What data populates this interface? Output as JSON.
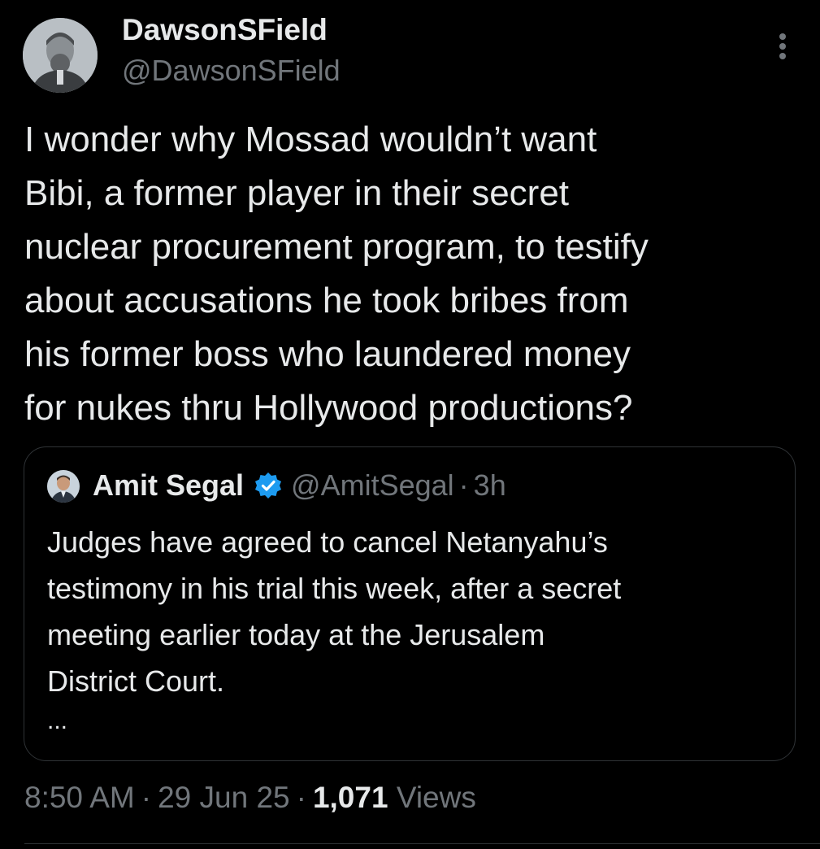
{
  "author": {
    "display_name": "DawsonSField",
    "handle": "@DawsonSField",
    "avatar_icon": "portrait-avatar"
  },
  "tweet_text": "I wonder why Mossad wouldn’t want\nBibi, a former player in their secret\nnuclear procurement program, to testify\nabout accusations he took bribes from\nhis former boss who laundered money\nfor nukes thru Hollywood productions?",
  "quoted_tweet": {
    "display_name": "Amit Segal",
    "verified_icon": "verified-badge-icon",
    "handle": "@AmitSegal",
    "separator": "·",
    "time": "3h",
    "text": "Judges have agreed to cancel Netanyahu’s\ntestimony in his trial this week, after a secret\nmeeting earlier today at the Jerusalem\nDistrict Court.",
    "ellipsis": "..."
  },
  "meta": {
    "time": "8:50 AM",
    "separator": "·",
    "date": "29 Jun 25",
    "views_count": "1,071",
    "views_label": "Views"
  },
  "colors": {
    "background": "#000000",
    "text_primary": "#e7e9ea",
    "text_secondary": "#71767b",
    "border": "#2f3336",
    "verified": "#1d9bf0"
  }
}
